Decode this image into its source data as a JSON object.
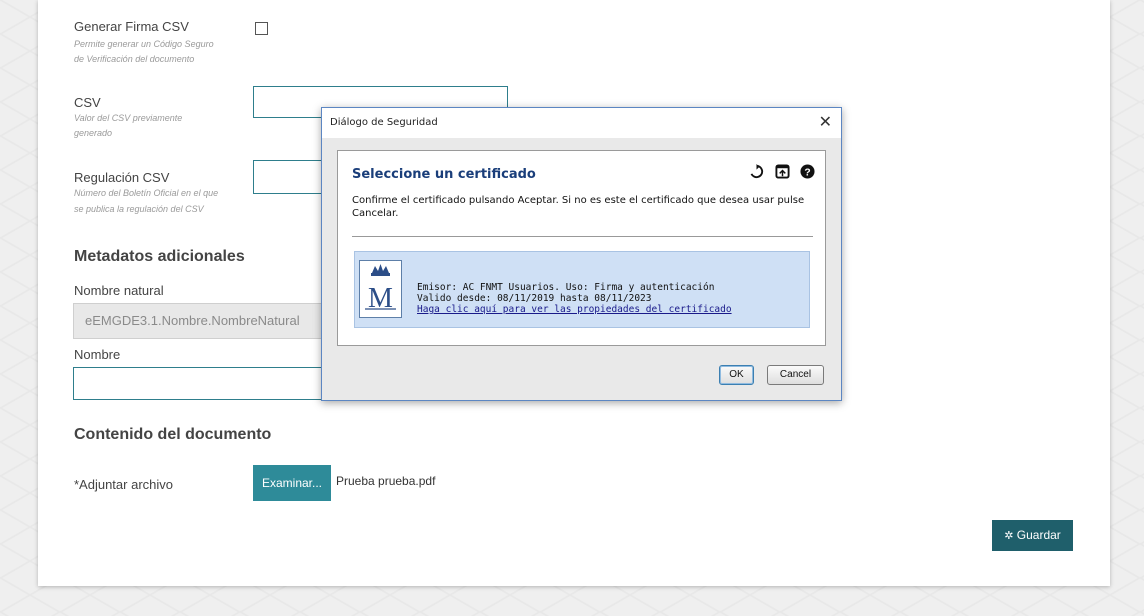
{
  "form": {
    "csv_sig": {
      "label": "Generar Firma CSV",
      "help1": "Permite generar un Código Seguro",
      "help2": "de Verificación del documento"
    },
    "csv": {
      "label": "CSV",
      "help1": "Valor del CSV previamente",
      "help2": "generado",
      "value": ""
    },
    "regulacion": {
      "label": "Regulación CSV",
      "help1": "Número del Boletín Oficial en el que",
      "help2": "se publica la regulación del CSV",
      "value": ""
    },
    "metadatos_title": "Metadatos adicionales",
    "nombre_natural": {
      "label": "Nombre natural",
      "value": "eEMGDE3.1.Nombre.NombreNatural"
    },
    "nombre": {
      "label": "Nombre",
      "value": ""
    },
    "contenido_title": "Contenido del documento",
    "adjuntar": {
      "label": "*Adjuntar archivo",
      "button": "Examinar...",
      "filename": "Prueba prueba.pdf"
    },
    "save_button": "Guardar"
  },
  "dialog": {
    "title": "Diálogo de Seguridad",
    "close": "✕",
    "heading": "Seleccione un certificado",
    "message": "Confirme el certificado pulsando Aceptar. Si no es este el certificado que desea usar pulse Cancelar.",
    "cert": {
      "emisor": "Emisor: AC FNMT Usuarios. Uso: Firma y autenticación",
      "validez": "Valido desde: 08/11/2019 hasta 08/11/2023",
      "link": "Haga clic aquí para ver las propiedades del certificado"
    },
    "ok": "OK",
    "cancel": "Cancel",
    "icons": [
      "refresh-icon",
      "open-icon",
      "help-icon"
    ]
  },
  "colors": {
    "accent": "#2e8b99",
    "accent_dark": "#1f5f6b",
    "dialog_heading": "#1a3e7a",
    "cert_bg": "#cfe0f5"
  }
}
